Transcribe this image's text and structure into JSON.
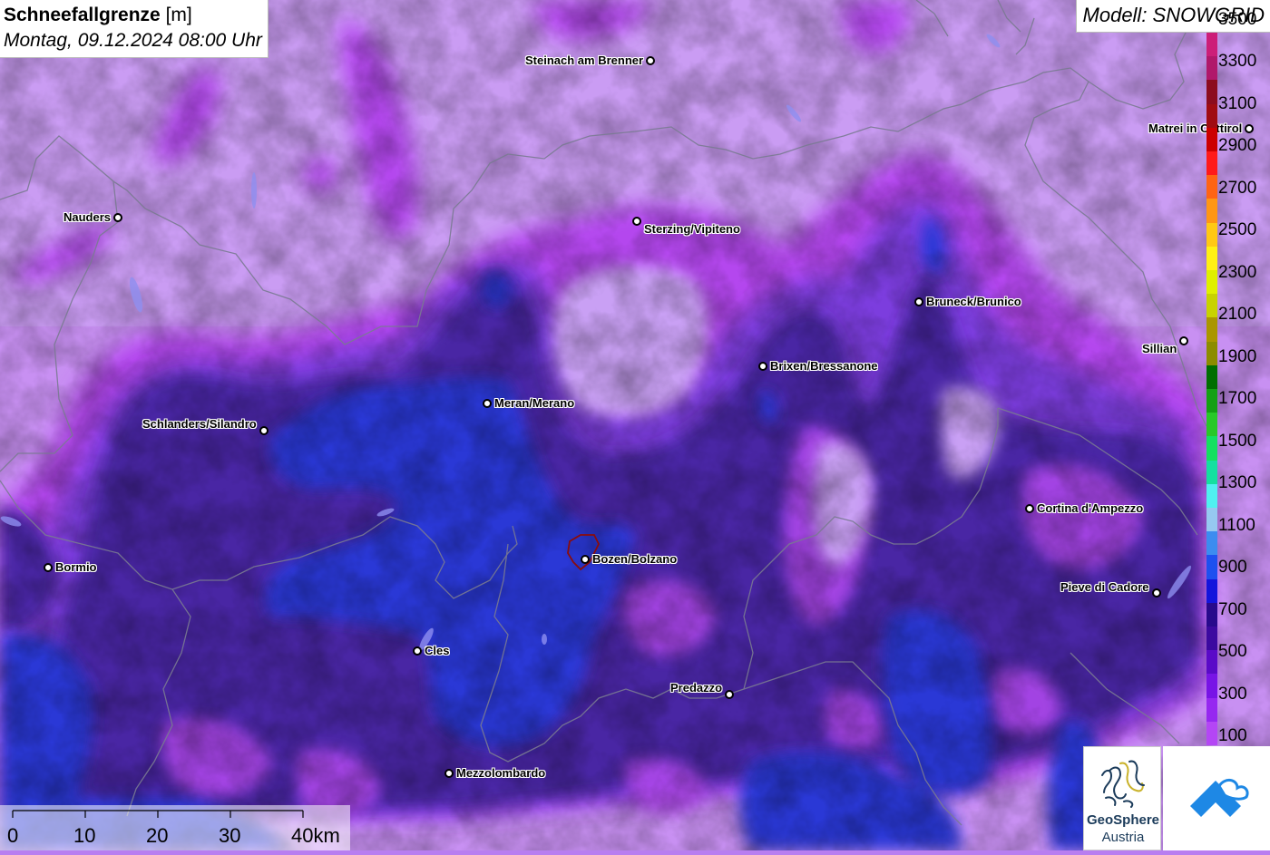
{
  "title": {
    "main": "Schneefallgrenze",
    "unit": "[m]",
    "subtitle": "Montag, 09.12.2024 08:00 Uhr"
  },
  "model": "Modell: SNOWGRID",
  "cities": [
    {
      "name": "Steinach am Brenner",
      "side": "left"
    },
    {
      "name": "Matrei in Osttirol",
      "side": "left"
    },
    {
      "name": "Nauders",
      "side": "left"
    },
    {
      "name": "Sterzing/Vipiteno",
      "side": "right"
    },
    {
      "name": "Bruneck/Brunico",
      "side": "right"
    },
    {
      "name": "Sillian",
      "side": "left"
    },
    {
      "name": "Brixen/Bressanone",
      "side": "right"
    },
    {
      "name": "Meran/Merano",
      "side": "right"
    },
    {
      "name": "Schlanders/Silandro",
      "side": "left"
    },
    {
      "name": "Cortina d'Ampezzo",
      "side": "right"
    },
    {
      "name": "Bormio",
      "side": "right"
    },
    {
      "name": "Bozen/Bolzano",
      "side": "right"
    },
    {
      "name": "Pieve di Cadore",
      "side": "left"
    },
    {
      "name": "Cles",
      "side": "right"
    },
    {
      "name": "Predazzo",
      "side": "left"
    },
    {
      "name": "Mezzolombardo",
      "side": "right"
    }
  ],
  "legend": {
    "labels": [
      "3500",
      "3300",
      "3100",
      "2900",
      "2700",
      "2500",
      "2300",
      "2100",
      "1900",
      "1700",
      "1500",
      "1300",
      "1100",
      "900",
      "700",
      "500",
      "300",
      "100"
    ],
    "colors": [
      "#cc1e78",
      "#b0186a",
      "#8c0c1e",
      "#a00c12",
      "#cc0000",
      "#ff1a1a",
      "#ff6414",
      "#ff9614",
      "#ffc814",
      "#fff014",
      "#e0f000",
      "#c8d200",
      "#aa9600",
      "#8c8c00",
      "#006e00",
      "#14a014",
      "#28c828",
      "#14e060",
      "#14e0a0",
      "#50f0f0",
      "#96c8f0",
      "#3c8cf0",
      "#1e50f0",
      "#1414dc",
      "#280a8c",
      "#3c0aa0",
      "#5a0ac8",
      "#7814e6",
      "#9628f0",
      "#b446f5"
    ]
  },
  "scale_bar": {
    "labels": [
      "0",
      "10",
      "20",
      "30",
      "40km"
    ]
  },
  "logos": {
    "geosphere_line1": "GeoSphere",
    "geosphere_line2": "Austria",
    "second": "snowflake-house-logo"
  },
  "colors": {
    "deep_blue": "#2c3ad8",
    "dark_purple": "#4c2aa6",
    "mid_purple": "#7d3ce0",
    "magenta": "#b448ee",
    "light_purple": "#c290f4",
    "pale_purple": "#cca8f6",
    "border_gray": "#7a7a90"
  }
}
